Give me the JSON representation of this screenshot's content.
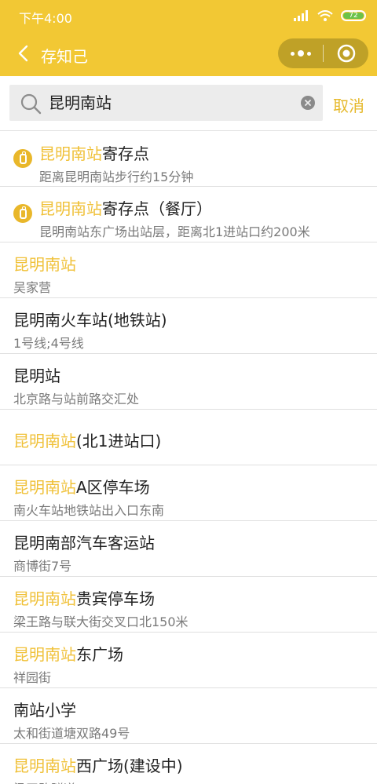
{
  "status_bar": {
    "time": "下午4:00",
    "battery": "72"
  },
  "nav": {
    "title": "存知己"
  },
  "search": {
    "query": "昆明南站",
    "cancel_label": "取消"
  },
  "results": [
    {
      "hl": "昆明南站",
      "rest": "寄存点",
      "sub": "距离昆明南站步行约15分钟",
      "pin": true
    },
    {
      "hl": "昆明南站",
      "rest": "寄存点（餐厅）",
      "sub": "昆明南站东广场出站层，距离北1进站口约200米",
      "pin": true
    },
    {
      "hl": "昆明南站",
      "rest": "",
      "sub": "吴家营",
      "pin": false
    },
    {
      "hl": "",
      "rest": "昆明南火车站(地铁站)",
      "sub": "1号线;4号线",
      "pin": false
    },
    {
      "hl": "",
      "rest": "昆明站",
      "sub": "北京路与站前路交汇处",
      "pin": false
    },
    {
      "hl": "昆明南站",
      "rest": "(北1进站口)",
      "sub": "",
      "pin": false
    },
    {
      "hl": "昆明南站",
      "rest": "A区停车场",
      "sub": "南火车站地铁站出入口东南",
      "pin": false
    },
    {
      "hl": "",
      "rest": "昆明南部汽车客运站",
      "sub": "商博街7号",
      "pin": false
    },
    {
      "hl": "昆明南站",
      "rest": "贵宾停车场",
      "sub": "梁王路与联大街交叉口北150米",
      "pin": false
    },
    {
      "hl": "昆明南站",
      "rest": "东广场",
      "sub": "祥园街",
      "pin": false
    },
    {
      "hl": "",
      "rest": "南站小学",
      "sub": "太和街道塘双路49号",
      "pin": false
    },
    {
      "hl": "昆明南站",
      "rest": "西广场(建设中)",
      "sub": "梁王路隧道",
      "pin": false
    }
  ]
}
